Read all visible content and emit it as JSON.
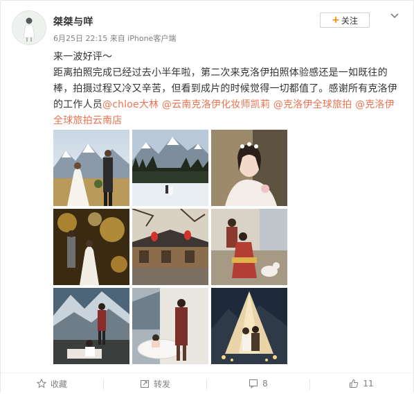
{
  "post": {
    "username": "桀桀与咩",
    "meta": "6月25日 22:15 来自 iPhone客户端",
    "follow_label": "关注",
    "text_line1": "来一波好评～",
    "text_line2": "距离拍照完成已经过去小半年啦，第二次来克洛伊拍照体验感还是一如既往的棒，拍摄过程又冷又辛苦，但看到成片的时候觉得一切都值了。感谢所有克洛伊的工作人员",
    "mentions": [
      "@chloe大林",
      "@云南克洛伊化妆师凯莉",
      "@克洛伊全球旅拍",
      "@克洛伊全球旅拍云南店"
    ]
  },
  "photos": [
    {
      "scene": "couple-snow-mountain-meadow"
    },
    {
      "scene": "snow-mountain-forest-small-couple"
    },
    {
      "scene": "bride-portrait-flower-crown"
    },
    {
      "scene": "couple-golden-light-bokeh"
    },
    {
      "scene": "old-town-street-red-lanterns"
    },
    {
      "scene": "couple-ethnic-costume-with-dog"
    },
    {
      "scene": "couple-mountain-picnic-camera"
    },
    {
      "scene": "couple-bathtub-mountain-view"
    },
    {
      "scene": "couple-tent-night-lights"
    }
  ],
  "actions": {
    "favorite_label": "收藏",
    "repost_label": "转发",
    "comment_count": "8",
    "like_count": "11"
  },
  "colors": {
    "mention": "#eb7350",
    "follow_plus": "#ff8200",
    "meta": "#808080"
  },
  "icons": [
    "chevron-down-icon",
    "star-icon",
    "repost-icon",
    "comment-icon",
    "thumbs-up-icon",
    "plus-icon"
  ]
}
